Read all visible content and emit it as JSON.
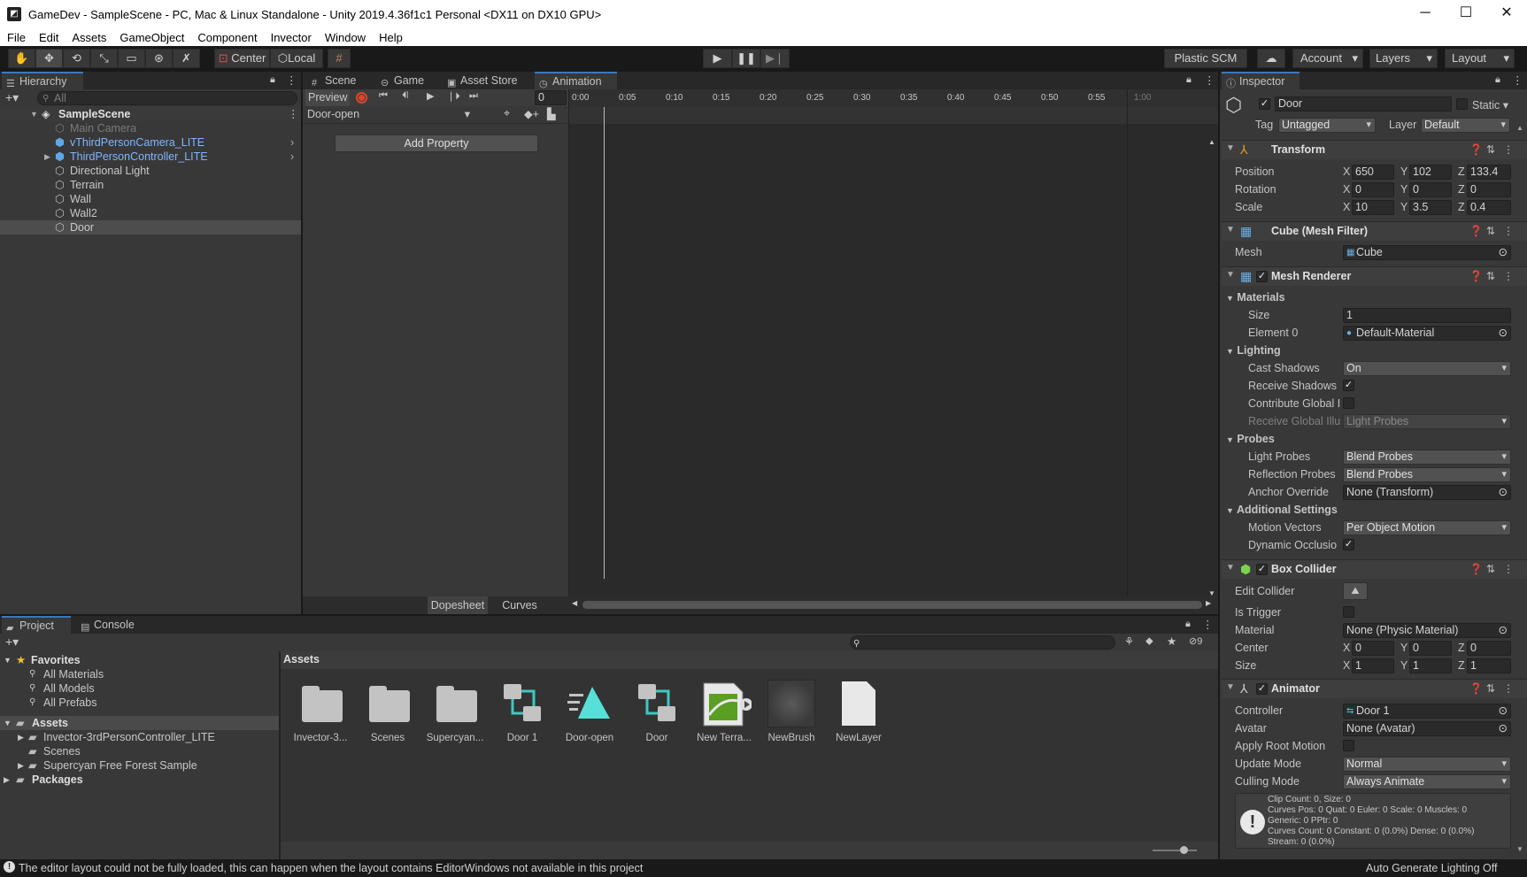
{
  "window": {
    "title": "GameDev - SampleScene - PC, Mac & Linux Standalone - Unity 2019.4.36f1c1 Personal <DX11 on DX10 GPU>"
  },
  "menu": [
    "File",
    "Edit",
    "Assets",
    "GameObject",
    "Component",
    "Invector",
    "Window",
    "Help"
  ],
  "toolbar": {
    "pivot": "Center",
    "space": "Local",
    "plastic": "Plastic SCM",
    "account": "Account",
    "layers": "Layers",
    "layout": "Layout"
  },
  "hierarchy": {
    "tab": "Hierarchy",
    "search_placeholder": "All",
    "scene": "SampleScene",
    "items": [
      {
        "label": "Main Camera"
      },
      {
        "label": "vThirdPersonCamera_LITE"
      },
      {
        "label": "ThirdPersonController_LITE"
      },
      {
        "label": "Directional Light"
      },
      {
        "label": "Terrain"
      },
      {
        "label": "Wall"
      },
      {
        "label": "Wall2"
      },
      {
        "label": "Door"
      }
    ]
  },
  "center_tabs": {
    "scene": "Scene",
    "game": "Game",
    "asset_store": "Asset Store",
    "animation": "Animation"
  },
  "animation": {
    "preview": "Preview",
    "frame": "0",
    "clip": "Door-open",
    "add_property": "Add Property",
    "dopesheet": "Dopesheet",
    "curves": "Curves",
    "ruler": [
      "0:00",
      "0:05",
      "0:10",
      "0:15",
      "0:20",
      "0:25",
      "0:30",
      "0:35",
      "0:40",
      "0:45",
      "0:50",
      "0:55",
      "1:00"
    ]
  },
  "project": {
    "tab_project": "Project",
    "tab_console": "Console",
    "hidden_count": "9",
    "favorites": "Favorites",
    "fav_items": [
      "All Materials",
      "All Models",
      "All Prefabs"
    ],
    "assets_root": "Assets",
    "asset_tree": [
      "Invector-3rdPersonController_LITE",
      "Scenes",
      "Supercyan Free Forest Sample"
    ],
    "packages": "Packages",
    "breadcrumb": "Assets",
    "grid": [
      "Invector-3...",
      "Scenes",
      "Supercyan...",
      "Door 1",
      "Door-open",
      "Door",
      "New Terra...",
      "NewBrush",
      "NewLayer"
    ]
  },
  "inspector": {
    "tab": "Inspector",
    "object_name": "Door",
    "static": "Static",
    "tag_label": "Tag",
    "tag": "Untagged",
    "layer_label": "Layer",
    "layer": "Default",
    "transform": {
      "title": "Transform",
      "position_label": "Position",
      "position": [
        "650",
        "102",
        "133.4"
      ],
      "rotation_label": "Rotation",
      "rotation": [
        "0",
        "0",
        "0"
      ],
      "scale_label": "Scale",
      "scale": [
        "10",
        "3.5",
        "0.4"
      ]
    },
    "mesh_filter": {
      "title": "Cube (Mesh Filter)",
      "mesh_label": "Mesh",
      "mesh": "Cube"
    },
    "mesh_renderer": {
      "title": "Mesh Renderer",
      "materials": "Materials",
      "size_label": "Size",
      "size": "1",
      "element0_label": "Element 0",
      "element0": "Default-Material",
      "lighting": "Lighting",
      "cast_shadows_label": "Cast Shadows",
      "cast_shadows": "On",
      "receive_shadows_label": "Receive Shadows",
      "contribute_gi_label": "Contribute Global I",
      "receive_gi_label": "Receive Global Illu",
      "receive_gi": "Light Probes",
      "probes": "Probes",
      "light_probes_label": "Light Probes",
      "light_probes": "Blend Probes",
      "reflection_probes_label": "Reflection Probes",
      "reflection_probes": "Blend Probes",
      "anchor_override_label": "Anchor Override",
      "anchor_override": "None (Transform)",
      "additional": "Additional Settings",
      "motion_vectors_label": "Motion Vectors",
      "motion_vectors": "Per Object Motion",
      "dynamic_occlusion_label": "Dynamic Occlusio"
    },
    "box_collider": {
      "title": "Box Collider",
      "edit_collider_label": "Edit Collider",
      "is_trigger_label": "Is Trigger",
      "material_label": "Material",
      "material": "None (Physic Material)",
      "center_label": "Center",
      "center": [
        "0",
        "0",
        "0"
      ],
      "size_label": "Size",
      "size": [
        "1",
        "1",
        "1"
      ]
    },
    "animator": {
      "title": "Animator",
      "controller_label": "Controller",
      "controller": "Door 1",
      "avatar_label": "Avatar",
      "avatar": "None (Avatar)",
      "apply_root_label": "Apply Root Motion",
      "update_mode_label": "Update Mode",
      "update_mode": "Normal",
      "culling_mode_label": "Culling Mode",
      "culling_mode": "Always Animate",
      "info": [
        "Clip Count: 0, Size: 0",
        "Curves Pos: 0 Quat: 0 Euler: 0 Scale: 0 Muscles: 0",
        "Generic: 0 PPtr: 0",
        "Curves Count: 0 Constant: 0 (0.0%) Dense: 0 (0.0%)",
        "Stream: 0 (0.0%)"
      ]
    }
  },
  "status": {
    "message": "The editor layout could not be fully loaded, this can happen when the layout contains EditorWindows not available in this project",
    "right": "Auto Generate Lighting Off"
  },
  "colors": {
    "accent": "#3a79bb",
    "link": "#7fb6ff",
    "animation_red": "#e0442a"
  }
}
